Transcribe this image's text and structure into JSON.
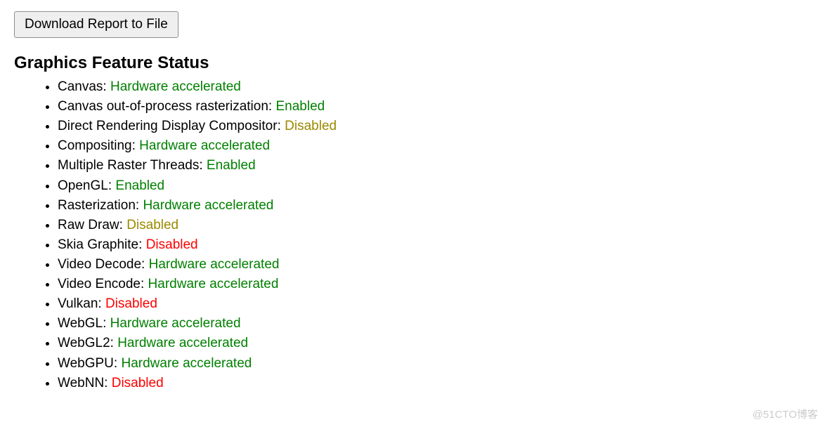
{
  "download_button_label": "Download Report to File",
  "heading": "Graphics Feature Status",
  "features": [
    {
      "name": "Canvas",
      "status": "Hardware accelerated",
      "class": "status-green"
    },
    {
      "name": "Canvas out-of-process rasterization",
      "status": "Enabled",
      "class": "status-green"
    },
    {
      "name": "Direct Rendering Display Compositor",
      "status": "Disabled",
      "class": "status-olive"
    },
    {
      "name": "Compositing",
      "status": "Hardware accelerated",
      "class": "status-green"
    },
    {
      "name": "Multiple Raster Threads",
      "status": "Enabled",
      "class": "status-green"
    },
    {
      "name": "OpenGL",
      "status": "Enabled",
      "class": "status-green"
    },
    {
      "name": "Rasterization",
      "status": "Hardware accelerated",
      "class": "status-green"
    },
    {
      "name": "Raw Draw",
      "status": "Disabled",
      "class": "status-olive"
    },
    {
      "name": "Skia Graphite",
      "status": "Disabled",
      "class": "status-red"
    },
    {
      "name": "Video Decode",
      "status": "Hardware accelerated",
      "class": "status-green"
    },
    {
      "name": "Video Encode",
      "status": "Hardware accelerated",
      "class": "status-green"
    },
    {
      "name": "Vulkan",
      "status": "Disabled",
      "class": "status-red"
    },
    {
      "name": "WebGL",
      "status": "Hardware accelerated",
      "class": "status-green"
    },
    {
      "name": "WebGL2",
      "status": "Hardware accelerated",
      "class": "status-green"
    },
    {
      "name": "WebGPU",
      "status": "Hardware accelerated",
      "class": "status-green"
    },
    {
      "name": "WebNN",
      "status": "Disabled",
      "class": "status-red"
    }
  ],
  "watermark": "@51CTO博客"
}
